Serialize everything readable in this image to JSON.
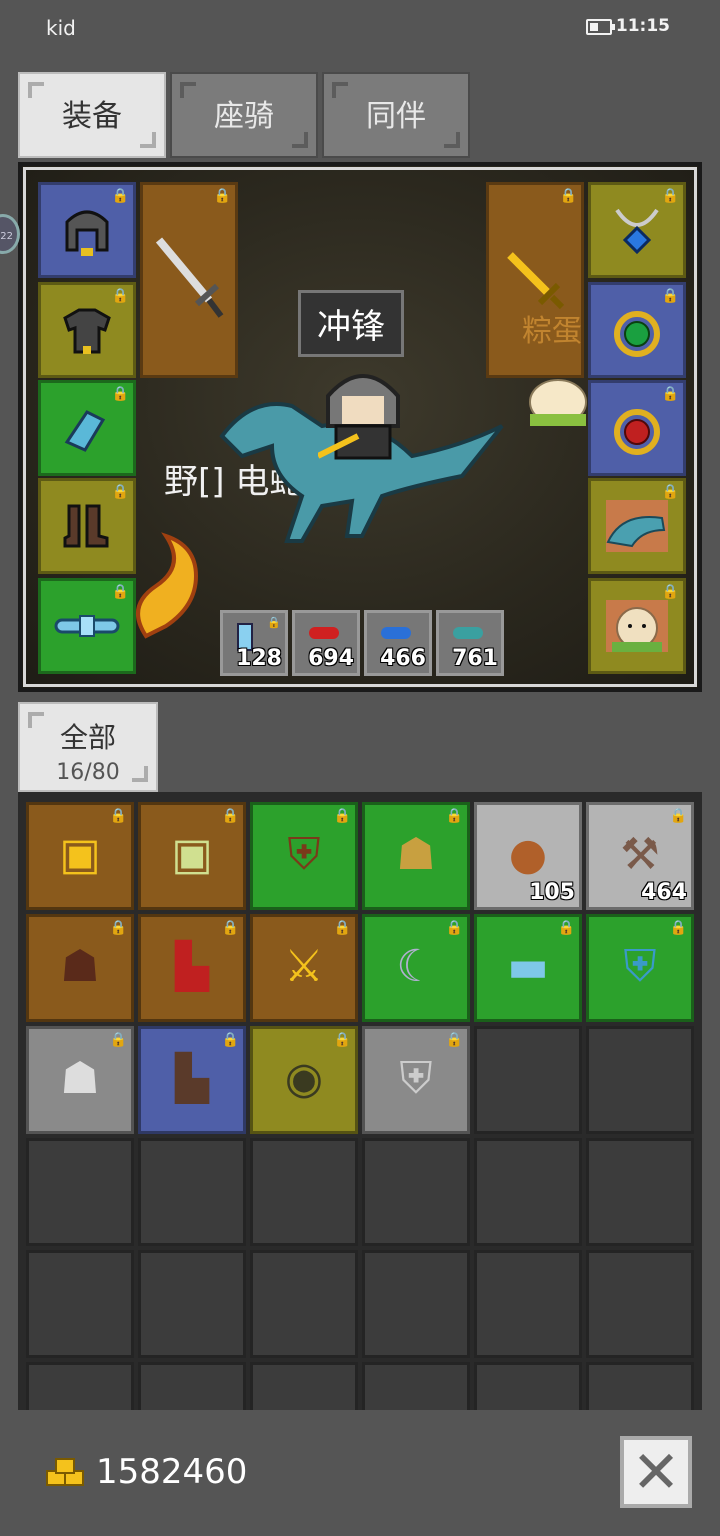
{
  "status_bar": {
    "user": "kid",
    "time": "11:15"
  },
  "tabs": [
    {
      "label": "装备",
      "active": true
    },
    {
      "label": "座骑",
      "active": false
    },
    {
      "label": "同伴",
      "active": false
    }
  ],
  "side_bubble": "22",
  "stage": {
    "badge": "冲锋",
    "overlay_text": "野[] 电蛇",
    "overlay_text2": "粽蛋",
    "left_slots": [
      {
        "icon": "helmet-icon",
        "color": "blue"
      },
      {
        "icon": "armor-icon",
        "color": "yellow"
      },
      {
        "icon": "gauntlet-icon",
        "color": "green"
      },
      {
        "icon": "boots-icon",
        "color": "yellow"
      },
      {
        "icon": "belt-icon",
        "color": "green"
      }
    ],
    "weapon_left": {
      "icon": "sword-icon",
      "color": "orange"
    },
    "weapon_right": {
      "icon": "golden-sword-icon",
      "color": "orange"
    },
    "right_slots": [
      {
        "icon": "amulet-icon",
        "color": "yellow"
      },
      {
        "icon": "green-ring-icon",
        "color": "blue"
      },
      {
        "icon": "red-ring-icon",
        "color": "blue"
      },
      {
        "icon": "raptor-portrait-icon",
        "color": "yellow"
      },
      {
        "icon": "companion-portrait-icon",
        "color": "yellow"
      }
    ],
    "counters": [
      {
        "icon": "potion-icon",
        "value": "128"
      },
      {
        "icon": "red-crystal-icon",
        "value": "694"
      },
      {
        "icon": "blue-crystal-icon",
        "value": "466"
      },
      {
        "icon": "teal-crystal-icon",
        "value": "761"
      }
    ]
  },
  "filter": {
    "label": "全部",
    "count": "16/80"
  },
  "inventory": [
    {
      "icon": "gold-ore-icon",
      "color": "orange",
      "lock": true,
      "qty": ""
    },
    {
      "icon": "green-ore-icon",
      "color": "orange",
      "lock": true,
      "qty": ""
    },
    {
      "icon": "leather-armor-icon",
      "color": "green",
      "lock": true,
      "qty": ""
    },
    {
      "icon": "gold-helmet-icon",
      "color": "green",
      "lock": true,
      "qty": ""
    },
    {
      "icon": "meat-icon",
      "color": "lightgray",
      "lock": false,
      "qty": "105"
    },
    {
      "icon": "shovel-icon",
      "color": "lightgray",
      "lock": true,
      "qty": "464"
    },
    {
      "icon": "brown-helmet-icon",
      "color": "orange",
      "lock": true,
      "qty": ""
    },
    {
      "icon": "red-boots-icon",
      "color": "orange",
      "lock": true,
      "qty": ""
    },
    {
      "icon": "golden-dagger-icon",
      "color": "orange",
      "lock": true,
      "qty": ""
    },
    {
      "icon": "scythe-icon",
      "color": "green",
      "lock": true,
      "qty": ""
    },
    {
      "icon": "belt-icon",
      "color": "green",
      "lock": true,
      "qty": ""
    },
    {
      "icon": "blue-armor-icon",
      "color": "green",
      "lock": true,
      "qty": ""
    },
    {
      "icon": "viking-helmet-icon",
      "color": "gray",
      "lock": true,
      "qty": ""
    },
    {
      "icon": "boots-icon",
      "color": "blue",
      "lock": true,
      "qty": ""
    },
    {
      "icon": "shield-icon",
      "color": "yellow",
      "lock": true,
      "qty": ""
    },
    {
      "icon": "steel-armor-icon",
      "color": "gray",
      "lock": true,
      "qty": ""
    }
  ],
  "gold": "1582460",
  "colors": {
    "blue": "#4f5fa8",
    "yellow": "#8f8a20",
    "green": "#2ca12c",
    "orange": "#8a5a1c",
    "gray": "#8a8a8a",
    "lightgray": "#b4b4b4"
  }
}
